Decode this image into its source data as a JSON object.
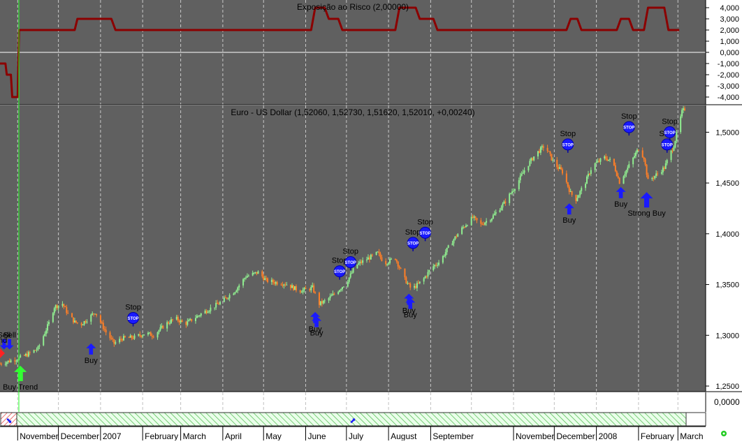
{
  "colors": {
    "panel_bg": "#606060",
    "risk_line": "#8b0000",
    "bull": "#90ee90",
    "bear": "#ff7f27",
    "signal_blue": "#1a1aff",
    "buy_trend_green": "#33ff33",
    "cursor_line": "#22ff22"
  },
  "scrollbar": {
    "left_label": "⬊",
    "thumb_label": "⬈"
  },
  "chart_data": [
    {
      "type": "line",
      "title": "Exposição ao Risco (2,00000)",
      "y_ticks": [
        "4,000",
        "3,000",
        "2,000",
        "1,000",
        "0,000",
        "-1,000",
        "-2,000",
        "-3,000",
        "-4,000"
      ],
      "ylim": [
        -4.5,
        4.5
      ],
      "x_start": "2006-10-26",
      "series": [
        {
          "points": [
            [
              "2006-10-19",
              -1.0
            ],
            [
              "2006-10-23",
              -1.0
            ],
            [
              "2006-10-24",
              -2.0
            ],
            [
              "2006-10-27",
              -2.0
            ],
            [
              "2006-10-28",
              -4.0
            ],
            [
              "2006-11-01",
              -4.0
            ],
            [
              "2006-11-02",
              2.0
            ],
            [
              "2006-12-13",
              2.0
            ],
            [
              "2006-12-15",
              3.0
            ],
            [
              "2007-01-09",
              3.0
            ],
            [
              "2007-01-12",
              2.0
            ],
            [
              "2007-06-05",
              2.0
            ],
            [
              "2007-06-08",
              4.0
            ],
            [
              "2007-06-15",
              4.0
            ],
            [
              "2007-06-18",
              3.0
            ],
            [
              "2007-06-25",
              3.0
            ],
            [
              "2007-06-28",
              2.0
            ],
            [
              "2007-08-06",
              2.0
            ],
            [
              "2007-08-09",
              4.0
            ],
            [
              "2007-08-21",
              4.0
            ],
            [
              "2007-08-24",
              3.0
            ],
            [
              "2007-09-03",
              3.0
            ],
            [
              "2007-09-06",
              2.0
            ],
            [
              "2007-12-10",
              2.0
            ],
            [
              "2007-12-13",
              3.0
            ],
            [
              "2007-12-18",
              3.0
            ],
            [
              "2007-12-21",
              2.0
            ],
            [
              "2008-01-16",
              2.0
            ],
            [
              "2008-01-19",
              3.0
            ],
            [
              "2008-01-25",
              3.0
            ],
            [
              "2008-01-28",
              2.0
            ],
            [
              "2008-02-05",
              2.0
            ],
            [
              "2008-02-08",
              4.0
            ],
            [
              "2008-02-20",
              4.0
            ],
            [
              "2008-02-23",
              2.0
            ],
            [
              "2008-03-02",
              2.0
            ]
          ]
        }
      ]
    },
    {
      "type": "candlestick",
      "title": "Euro - US Dollar (1,52060, 1,52730, 1,51620, 1,52010, +0,00240)",
      "y_ticks": [
        "1,5000",
        "1,4500",
        "1,4000",
        "1,3500",
        "1,3000",
        "1,2500"
      ],
      "ylim": [
        1.2445,
        1.5264
      ],
      "x_labels": [
        "November",
        "December",
        "2007",
        "February",
        "March",
        "April",
        "May",
        "June",
        "July",
        "August",
        "September",
        "November",
        "December",
        "2008",
        "February",
        "March"
      ],
      "x_label_dates": [
        "2006-11-01",
        "2006-12-01",
        "2007-01-01",
        "2007-02-01",
        "2007-03-01",
        "2007-04-01",
        "2007-05-01",
        "2007-06-01",
        "2007-07-01",
        "2007-08-01",
        "2007-09-01",
        "2007-11-01",
        "2007-12-01",
        "2008-01-01",
        "2008-02-01",
        "2008-03-01"
      ],
      "gridlines_at": [
        "2006-11-01",
        "2006-12-01",
        "2007-01-01",
        "2007-02-01",
        "2007-03-01",
        "2007-04-01",
        "2007-05-01",
        "2007-06-01",
        "2007-07-01",
        "2007-08-01",
        "2007-09-01",
        "2007-10-01",
        "2007-11-01",
        "2007-12-01",
        "2008-01-01",
        "2008-02-01",
        "2008-03-01"
      ],
      "date_range": [
        "2006-10-19",
        "2008-03-06"
      ],
      "close_path": [
        [
          "2006-10-19",
          1.272
        ],
        [
          "2006-11-01",
          1.277
        ],
        [
          "2006-11-08",
          1.281
        ],
        [
          "2006-11-16",
          1.287
        ],
        [
          "2006-11-24",
          1.312
        ],
        [
          "2006-11-28",
          1.328
        ],
        [
          "2006-12-04",
          1.331
        ],
        [
          "2006-12-08",
          1.321
        ],
        [
          "2006-12-13",
          1.313
        ],
        [
          "2006-12-18",
          1.311
        ],
        [
          "2006-12-24",
          1.318
        ],
        [
          "2006-12-28",
          1.323
        ],
        [
          "2007-01-05",
          1.303
        ],
        [
          "2007-01-11",
          1.292
        ],
        [
          "2007-01-17",
          1.297
        ],
        [
          "2007-01-26",
          1.298
        ],
        [
          "2007-02-03",
          1.302
        ],
        [
          "2007-02-09",
          1.3
        ],
        [
          "2007-02-18",
          1.311
        ],
        [
          "2007-02-25",
          1.317
        ],
        [
          "2007-03-04",
          1.311
        ],
        [
          "2007-03-10",
          1.316
        ],
        [
          "2007-03-17",
          1.322
        ],
        [
          "2007-03-25",
          1.328
        ],
        [
          "2007-04-01",
          1.334
        ],
        [
          "2007-04-10",
          1.344
        ],
        [
          "2007-04-18",
          1.358
        ],
        [
          "2007-04-27",
          1.362
        ],
        [
          "2007-05-03",
          1.354
        ],
        [
          "2007-05-10",
          1.352
        ],
        [
          "2007-05-17",
          1.351
        ],
        [
          "2007-05-27",
          1.344
        ],
        [
          "2007-06-02",
          1.345
        ],
        [
          "2007-06-06",
          1.347
        ],
        [
          "2007-06-11",
          1.331
        ],
        [
          "2007-06-16",
          1.334
        ],
        [
          "2007-06-24",
          1.343
        ],
        [
          "2007-07-01",
          1.352
        ],
        [
          "2007-07-08",
          1.369
        ],
        [
          "2007-07-16",
          1.375
        ],
        [
          "2007-07-24",
          1.381
        ],
        [
          "2007-07-29",
          1.371
        ],
        [
          "2007-08-06",
          1.376
        ],
        [
          "2007-08-13",
          1.355
        ],
        [
          "2007-08-18",
          1.345
        ],
        [
          "2007-08-26",
          1.354
        ],
        [
          "2007-09-02",
          1.367
        ],
        [
          "2007-09-08",
          1.373
        ],
        [
          "2007-09-16",
          1.391
        ],
        [
          "2007-09-24",
          1.405
        ],
        [
          "2007-10-02",
          1.416
        ],
        [
          "2007-10-08",
          1.409
        ],
        [
          "2007-10-16",
          1.416
        ],
        [
          "2007-10-25",
          1.43
        ],
        [
          "2007-11-03",
          1.448
        ],
        [
          "2007-11-10",
          1.465
        ],
        [
          "2007-11-17",
          1.478
        ],
        [
          "2007-11-24",
          1.487
        ],
        [
          "2007-12-01",
          1.469
        ],
        [
          "2007-12-07",
          1.461
        ],
        [
          "2007-12-13",
          1.44
        ],
        [
          "2007-12-17",
          1.434
        ],
        [
          "2007-12-24",
          1.451
        ],
        [
          "2007-12-29",
          1.467
        ],
        [
          "2008-01-07",
          1.475
        ],
        [
          "2008-01-13",
          1.471
        ],
        [
          "2008-01-18",
          1.451
        ],
        [
          "2008-01-25",
          1.467
        ],
        [
          "2008-02-01",
          1.484
        ],
        [
          "2008-02-05",
          1.475
        ],
        [
          "2008-02-08",
          1.452
        ],
        [
          "2008-02-13",
          1.457
        ],
        [
          "2008-02-20",
          1.465
        ],
        [
          "2008-02-27",
          1.487
        ],
        [
          "2008-03-04",
          1.52
        ],
        [
          "2008-03-06",
          1.523
        ]
      ],
      "signals": [
        {
          "type": "sell",
          "date": "2006-10-22",
          "price": 1.286,
          "label": "Sell"
        },
        {
          "type": "sell",
          "date": "2006-10-26",
          "price": 1.286,
          "label": "Sell"
        },
        {
          "type": "sell",
          "date": "2006-10-17",
          "price": 1.281,
          "label": "Trend"
        },
        {
          "type": "stop",
          "date": "2007-01-25",
          "price": 1.317,
          "label": "Stop"
        },
        {
          "type": "stop",
          "date": "2007-06-26",
          "price": 1.363,
          "label": "Stop"
        },
        {
          "type": "stop",
          "date": "2007-07-04",
          "price": 1.372,
          "label": "Stop"
        },
        {
          "type": "stop",
          "date": "2007-08-19",
          "price": 1.391,
          "label": "Stop"
        },
        {
          "type": "stop",
          "date": "2007-08-28",
          "price": 1.401,
          "label": "Stop"
        },
        {
          "type": "stop",
          "date": "2007-12-11",
          "price": 1.488,
          "label": "Stop"
        },
        {
          "type": "stop",
          "date": "2008-01-25",
          "price": 1.505,
          "label": "Stop"
        },
        {
          "type": "stop",
          "date": "2008-02-22",
          "price": 1.488,
          "label": "Stop"
        },
        {
          "type": "stop",
          "date": "2008-02-24",
          "price": 1.5,
          "label": "Stop"
        },
        {
          "type": "buy",
          "date": "2006-11-03",
          "price": 1.27,
          "label": "Buy Trend"
        },
        {
          "type": "buy",
          "date": "2006-12-25",
          "price": 1.292,
          "label": "Buy"
        },
        {
          "type": "buy",
          "date": "2007-06-08",
          "price": 1.323,
          "label": "Buy"
        },
        {
          "type": "buy",
          "date": "2007-06-09",
          "price": 1.319,
          "label": "Buy"
        },
        {
          "type": "buy",
          "date": "2007-08-16",
          "price": 1.341,
          "label": "Buy"
        },
        {
          "type": "buy",
          "date": "2007-08-17",
          "price": 1.337,
          "label": "Buy"
        },
        {
          "type": "buy",
          "date": "2007-12-12",
          "price": 1.43,
          "label": "Buy"
        },
        {
          "type": "buy",
          "date": "2008-01-19",
          "price": 1.446,
          "label": "Buy"
        },
        {
          "type": "buy",
          "date": "2008-02-07",
          "price": 1.441,
          "label": "Strong Buy"
        }
      ]
    },
    {
      "type": "line",
      "title": "",
      "y_ticks": [
        "0,0000"
      ]
    }
  ]
}
